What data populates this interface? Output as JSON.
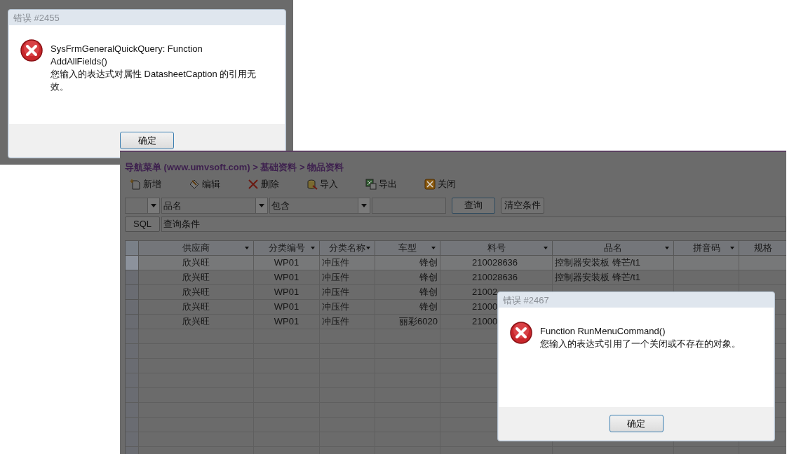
{
  "dialogs": [
    {
      "title": "错误 #2455",
      "message": [
        "SysFrmGeneralQuickQuery: Function AddAllFields()",
        "您输入的表达式对属性 DatasheetCaption 的引用无效。"
      ],
      "button": "确定"
    },
    {
      "title": "错误 #2467",
      "message": [
        "Function RunMenuCommand()",
        "您输入的表达式引用了一个关闭或不存在的对象。"
      ],
      "button": "确定"
    }
  ],
  "app": {
    "breadcrumb": "导航菜单 (www.umvsoft.com) > 基础资料 > 物品资料",
    "toolbar": [
      {
        "kind": "new",
        "label": "新增"
      },
      {
        "kind": "edit",
        "label": "编辑"
      },
      {
        "kind": "delete",
        "label": "删除"
      },
      {
        "kind": "import",
        "label": "导入"
      },
      {
        "kind": "export",
        "label": "导出"
      },
      {
        "kind": "close",
        "label": "关闭"
      }
    ],
    "filter": {
      "field": "品名",
      "operator": "包含",
      "query_button": "查询",
      "clear_button": "清空条件",
      "sql_button": "SQL",
      "condition": "查询条件"
    },
    "table": {
      "columns": [
        {
          "label": "供应商",
          "menu": true
        },
        {
          "label": "分类编号",
          "menu": true
        },
        {
          "label": "分类名称",
          "menu": true
        },
        {
          "label": "车型",
          "menu": true
        },
        {
          "label": "料号",
          "menu": true
        },
        {
          "label": "品名",
          "menu": true
        },
        {
          "label": "拼音码",
          "menu": true
        },
        {
          "label": "规格",
          "menu": false
        }
      ],
      "rows": [
        {
          "selected": true,
          "cells": [
            "欣兴旺",
            "WP01",
            "冲压件",
            "锋创",
            "210028636",
            "控制器安装板 锋芒/t1"
          ]
        },
        {
          "selected": false,
          "cells": [
            "欣兴旺",
            "WP01",
            "冲压件",
            "锋创",
            "210028636",
            "控制器安装板 锋芒/t1"
          ]
        },
        {
          "selected": false,
          "cells": [
            "欣兴旺",
            "WP01",
            "冲压件",
            "锋创",
            "21002"
          ]
        },
        {
          "selected": false,
          "cells": [
            "欣兴旺",
            "WP01",
            "冲压件",
            "锋创",
            "21000"
          ]
        },
        {
          "selected": false,
          "cells": [
            "欣兴旺",
            "WP01",
            "冲压件",
            "丽彩6020",
            "21000"
          ]
        }
      ]
    }
  }
}
